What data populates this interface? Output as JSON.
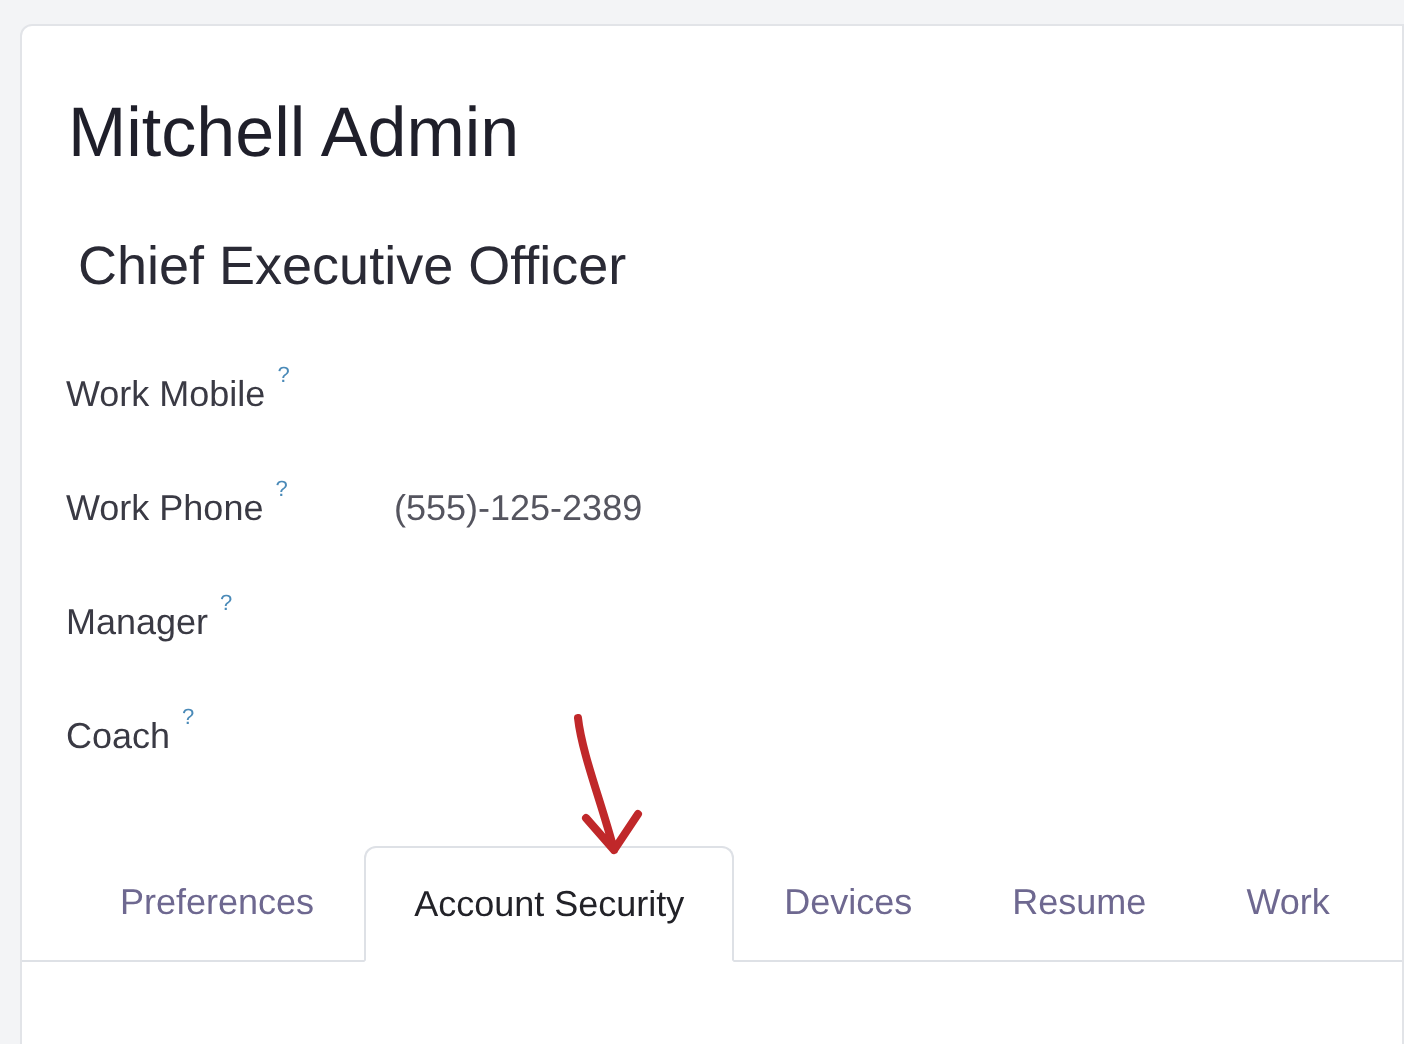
{
  "employee": {
    "name": "Mitchell Admin",
    "job_title": "Chief Executive Officer"
  },
  "fields": [
    {
      "label": "Work Mobile",
      "help": "?"
    },
    {
      "label": "Work Phone",
      "help": "?",
      "value": "(555)-125-2389"
    },
    {
      "label": "Manager",
      "help": "?"
    },
    {
      "label": "Coach",
      "help": "?"
    }
  ],
  "tabs": [
    {
      "label": "Preferences",
      "selected": false
    },
    {
      "label": "Account Security",
      "selected": true
    },
    {
      "label": "Devices",
      "selected": false
    },
    {
      "label": "Resume",
      "selected": false
    },
    {
      "label": "Work",
      "selected": false
    }
  ]
}
